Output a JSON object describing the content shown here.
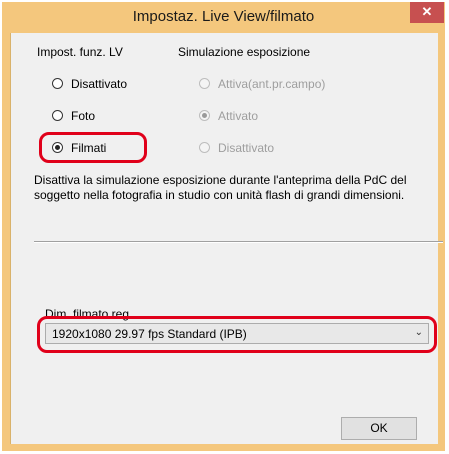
{
  "window": {
    "title": "Impostaz. Live View/filmato",
    "close_icon": "close-icon"
  },
  "lv_function": {
    "heading": "Impost. funz. LV",
    "options": [
      {
        "label": "Disattivato",
        "checked": false
      },
      {
        "label": "Foto",
        "checked": false
      },
      {
        "label": "Filmati",
        "checked": true
      }
    ]
  },
  "exposure_simulation": {
    "heading": "Simulazione esposizione",
    "options": [
      {
        "label": "Attiva(ant.pr.campo)",
        "checked": false,
        "disabled": true
      },
      {
        "label": "Attivato",
        "checked": true,
        "disabled": true
      },
      {
        "label": "Disattivato",
        "checked": false,
        "disabled": true
      }
    ]
  },
  "description": "Disattiva la simulazione esposizione durante l'anteprima della PdC del soggetto nella fotografia in studio con unità flash di grandi dimensioni.",
  "movie_size": {
    "label": "Dim. filmato reg.",
    "selected": "1920x1080  29.97 fps Standard (IPB)"
  },
  "buttons": {
    "ok": "OK"
  },
  "colors": {
    "title_bar": "#f4c77d",
    "close_button": "#c75050",
    "highlight": "#e0001a",
    "dialog_bg": "#f0f0f0"
  }
}
